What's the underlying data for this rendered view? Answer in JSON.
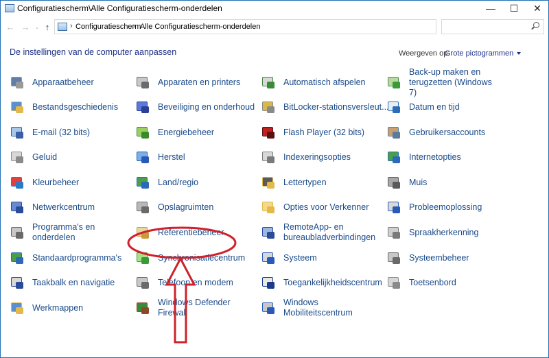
{
  "window": {
    "title": "Configuratiescherm\\Alle Configuratiescherm-onderdelen",
    "controls": {
      "minimize": "—",
      "maximize": "☐",
      "close": "✕"
    }
  },
  "address": {
    "breadcrumbs": [
      "Configuratiescherm",
      "Alle Configuratiescherm-onderdelen"
    ],
    "search_placeholder": ""
  },
  "heading": "De instellingen van de computer aanpassen",
  "view": {
    "label": "Weergeven op:",
    "value": "Grote pictogrammen"
  },
  "items": [
    {
      "label": "Apparaatbeheer",
      "icon": "device-manager-icon"
    },
    {
      "label": "Apparaten en printers",
      "icon": "printer-icon"
    },
    {
      "label": "Automatisch afspelen",
      "icon": "autoplay-icon"
    },
    {
      "label": "Back-up maken en terugzetten (Windows 7)",
      "icon": "backup-icon"
    },
    {
      "label": "Bestandsgeschiedenis",
      "icon": "file-history-icon"
    },
    {
      "label": "Beveiliging en onderhoud",
      "icon": "security-flag-icon"
    },
    {
      "label": "BitLocker-stationsversleut...",
      "icon": "bitlocker-icon"
    },
    {
      "label": "Datum en tijd",
      "icon": "calendar-clock-icon"
    },
    {
      "label": "E-mail (32 bits)",
      "icon": "mail-icon"
    },
    {
      "label": "Energiebeheer",
      "icon": "power-icon"
    },
    {
      "label": "Flash Player (32 bits)",
      "icon": "flash-icon"
    },
    {
      "label": "Gebruikersaccounts",
      "icon": "users-icon"
    },
    {
      "label": "Geluid",
      "icon": "speaker-icon"
    },
    {
      "label": "Herstel",
      "icon": "recovery-icon"
    },
    {
      "label": "Indexeringsopties",
      "icon": "indexing-icon"
    },
    {
      "label": "Internetopties",
      "icon": "internet-options-icon"
    },
    {
      "label": "Kleurbeheer",
      "icon": "color-management-icon"
    },
    {
      "label": "Land/regio",
      "icon": "globe-icon"
    },
    {
      "label": "Lettertypen",
      "icon": "fonts-icon"
    },
    {
      "label": "Muis",
      "icon": "mouse-icon"
    },
    {
      "label": "Netwerkcentrum",
      "icon": "network-icon"
    },
    {
      "label": "Opslagruimten",
      "icon": "storage-icon"
    },
    {
      "label": "Opties voor Verkenner",
      "icon": "folder-options-icon"
    },
    {
      "label": "Probleemoplossing",
      "icon": "troubleshoot-icon"
    },
    {
      "label": "Programma's en onderdelen",
      "icon": "programs-icon"
    },
    {
      "label": "Referentiebeheer",
      "icon": "credential-manager-icon"
    },
    {
      "label": "RemoteApp- en bureaubladverbindingen",
      "icon": "remote-desktop-icon"
    },
    {
      "label": "Spraakherkenning",
      "icon": "microphone-icon"
    },
    {
      "label": "Standaardprogramma's",
      "icon": "default-programs-icon"
    },
    {
      "label": "Synchronisatiecentrum",
      "icon": "sync-icon"
    },
    {
      "label": "Systeem",
      "icon": "system-icon"
    },
    {
      "label": "Systeembeheer",
      "icon": "admin-tools-icon"
    },
    {
      "label": "Taakbalk en navigatie",
      "icon": "taskbar-icon"
    },
    {
      "label": "Telefoon en modem",
      "icon": "phone-modem-icon"
    },
    {
      "label": "Toegankelijkheidscentrum",
      "icon": "accessibility-icon"
    },
    {
      "label": "Toetsenbord",
      "icon": "keyboard-icon"
    },
    {
      "label": "Werkmappen",
      "icon": "work-folders-icon"
    },
    {
      "label": "Windows Defender Firewall",
      "icon": "firewall-icon"
    },
    {
      "label": "Windows Mobiliteitscentrum",
      "icon": "mobility-center-icon"
    }
  ],
  "annotation": {
    "color": "#d0202a"
  }
}
